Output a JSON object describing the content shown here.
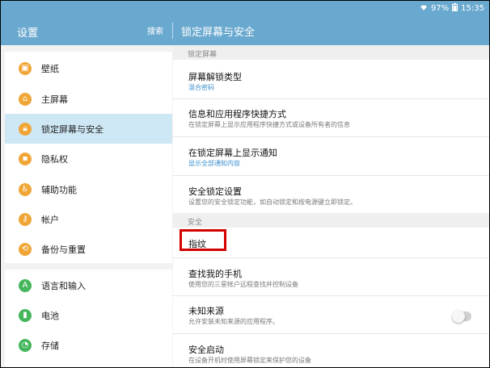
{
  "status": {
    "battery": "97%",
    "time": "15:35"
  },
  "appbar": {
    "title": "设置",
    "search": "搜索",
    "section": "锁定屏幕与安全"
  },
  "sidebar": {
    "items": [
      {
        "label": "壁纸",
        "icon": "wallpaper-icon"
      },
      {
        "label": "主屏幕",
        "icon": "home-icon"
      },
      {
        "label": "锁定屏幕与安全",
        "icon": "lock-icon",
        "active": true
      },
      {
        "label": "隐私权",
        "icon": "privacy-icon"
      },
      {
        "label": "辅助功能",
        "icon": "accessibility-icon"
      },
      {
        "label": "帐户",
        "icon": "key-icon"
      },
      {
        "label": "备份与重置",
        "icon": "backup-icon"
      },
      {
        "label": "语言和输入",
        "icon": "language-icon"
      },
      {
        "label": "电池",
        "icon": "battery-icon"
      },
      {
        "label": "存储",
        "icon": "storage-icon"
      }
    ]
  },
  "main": {
    "header1": "锁定屏幕",
    "header2": "安全",
    "rows": [
      {
        "title": "屏幕解锁类型",
        "sub": "混合密码"
      },
      {
        "title": "信息和应用程序快捷方式",
        "sub": "在锁定屏幕上显示应用程序快捷方式或设备所有者的信息"
      },
      {
        "title": "在锁定屏幕上显示通知",
        "sub": "显示全部通知内容"
      },
      {
        "title": "安全锁定设置",
        "sub": "设置您的安全锁定功能，如自动锁定和按电源键立即锁定。"
      },
      {
        "title": "指纹",
        "sub": ""
      },
      {
        "title": "查找我的手机",
        "sub": "使用您的三星帐户远程查找并控制设备"
      },
      {
        "title": "未知来源",
        "sub": "允许安装未知来源的应用程序。"
      },
      {
        "title": "安全启动",
        "sub": "在设备开机时使用屏幕锁定来保护您的设备"
      }
    ]
  },
  "colors": {
    "accent": "#6aa9cf",
    "active": "#cde7f5",
    "icon_orange": "#f0a637",
    "icon_green": "#44b65b",
    "highlight": "#d40000"
  }
}
